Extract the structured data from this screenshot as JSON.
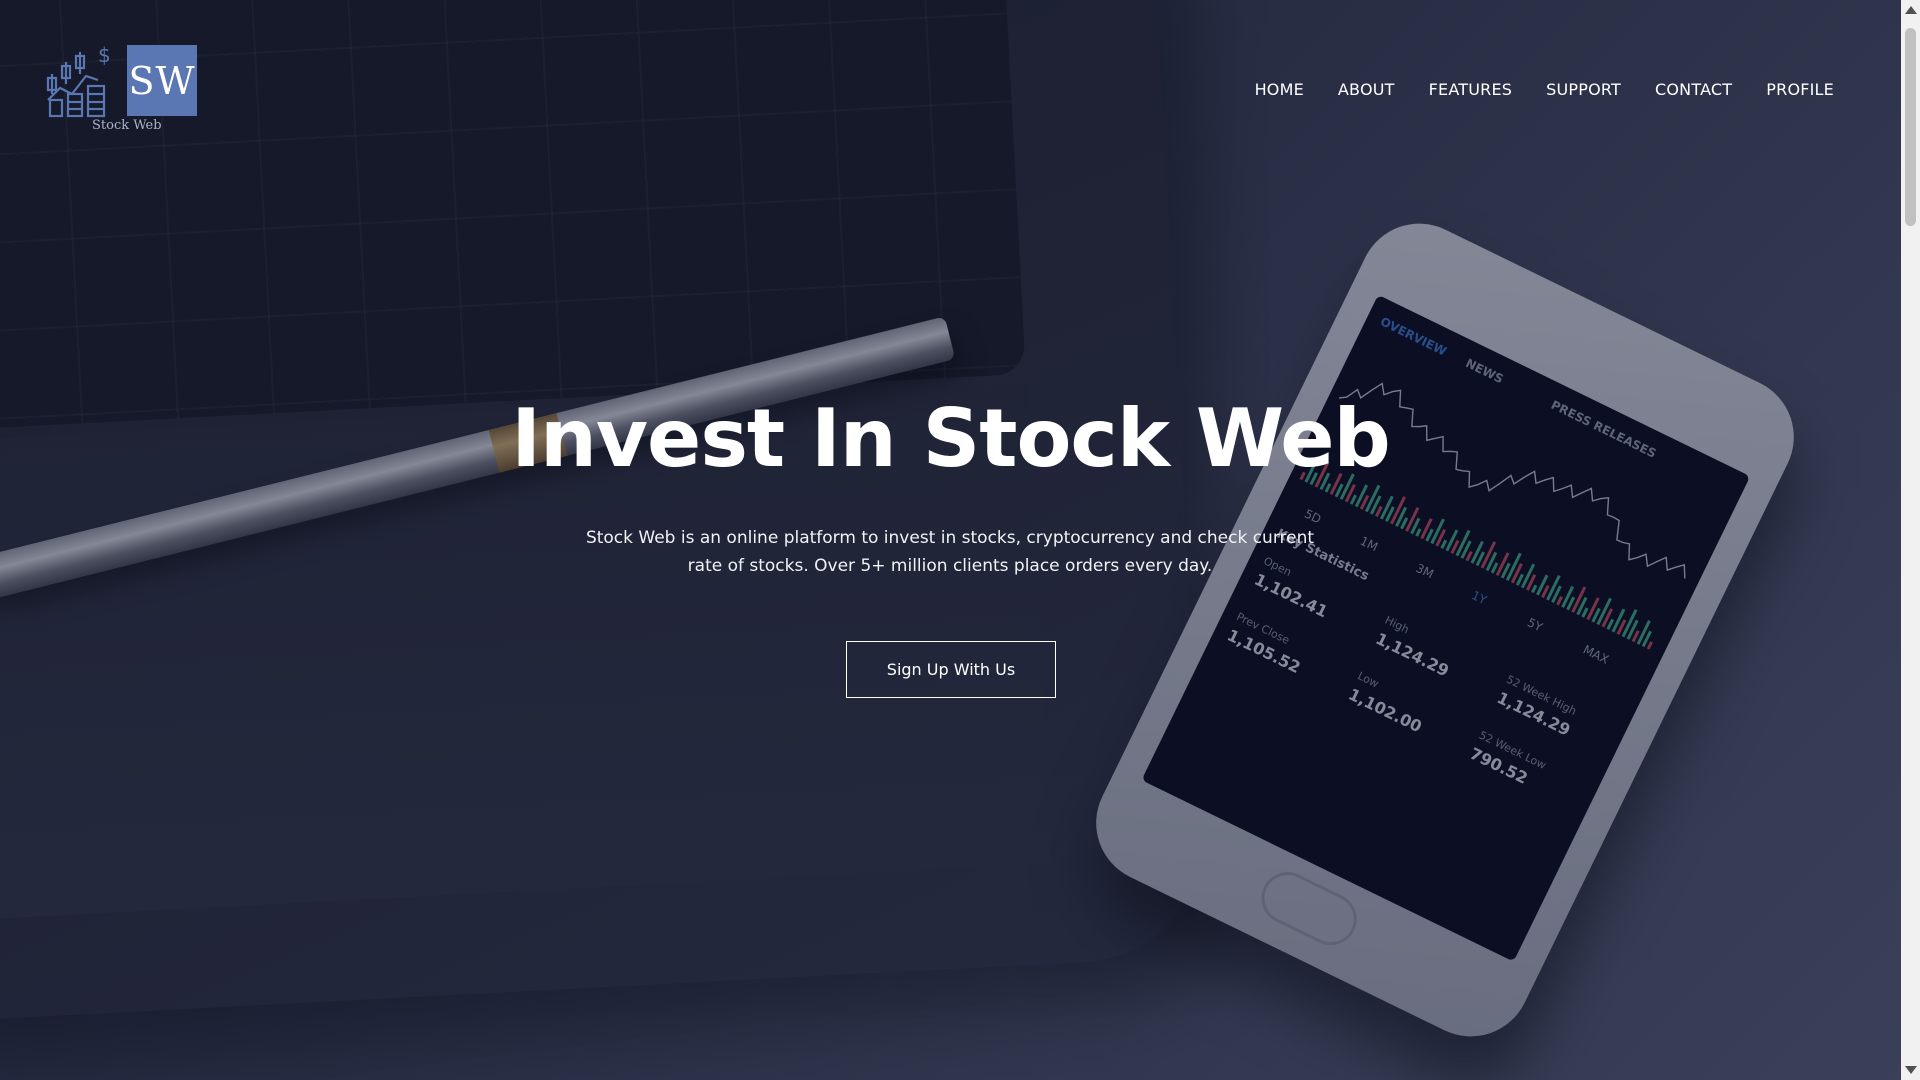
{
  "brand": {
    "monogram": "SW",
    "caption": "Stock Web",
    "accent": "#5a76b3"
  },
  "nav": {
    "items": [
      {
        "label": "HOME"
      },
      {
        "label": "ABOUT"
      },
      {
        "label": "FEATURES"
      },
      {
        "label": "SUPPORT"
      },
      {
        "label": "CONTACT"
      },
      {
        "label": "PROFILE"
      }
    ]
  },
  "hero": {
    "title": "Invest In Stock Web",
    "description": "Stock Web is an online platform to invest in stocks, cryptocurrency and check current rate of stocks. Over 5+ million clients place orders every day.",
    "cta_label": "Sign Up With Us"
  },
  "phone_screen": {
    "tabs": [
      "OVERVIEW",
      "NEWS",
      "PRESS RELEASES"
    ],
    "ranges": [
      "5D",
      "1M",
      "3M",
      "1Y",
      "5Y",
      "MAX"
    ],
    "section": "Key Statistics",
    "stats": [
      {
        "label": "Open",
        "value": "1,102.41"
      },
      {
        "label": "High",
        "value": "1,124.29"
      },
      {
        "label": "52 Week High",
        "value": "1,124.29"
      },
      {
        "label": "Prev Close",
        "value": "1,105.52"
      },
      {
        "label": "Low",
        "value": "1,102.00"
      },
      {
        "label": "52 Week Low",
        "value": "790.52"
      }
    ]
  }
}
